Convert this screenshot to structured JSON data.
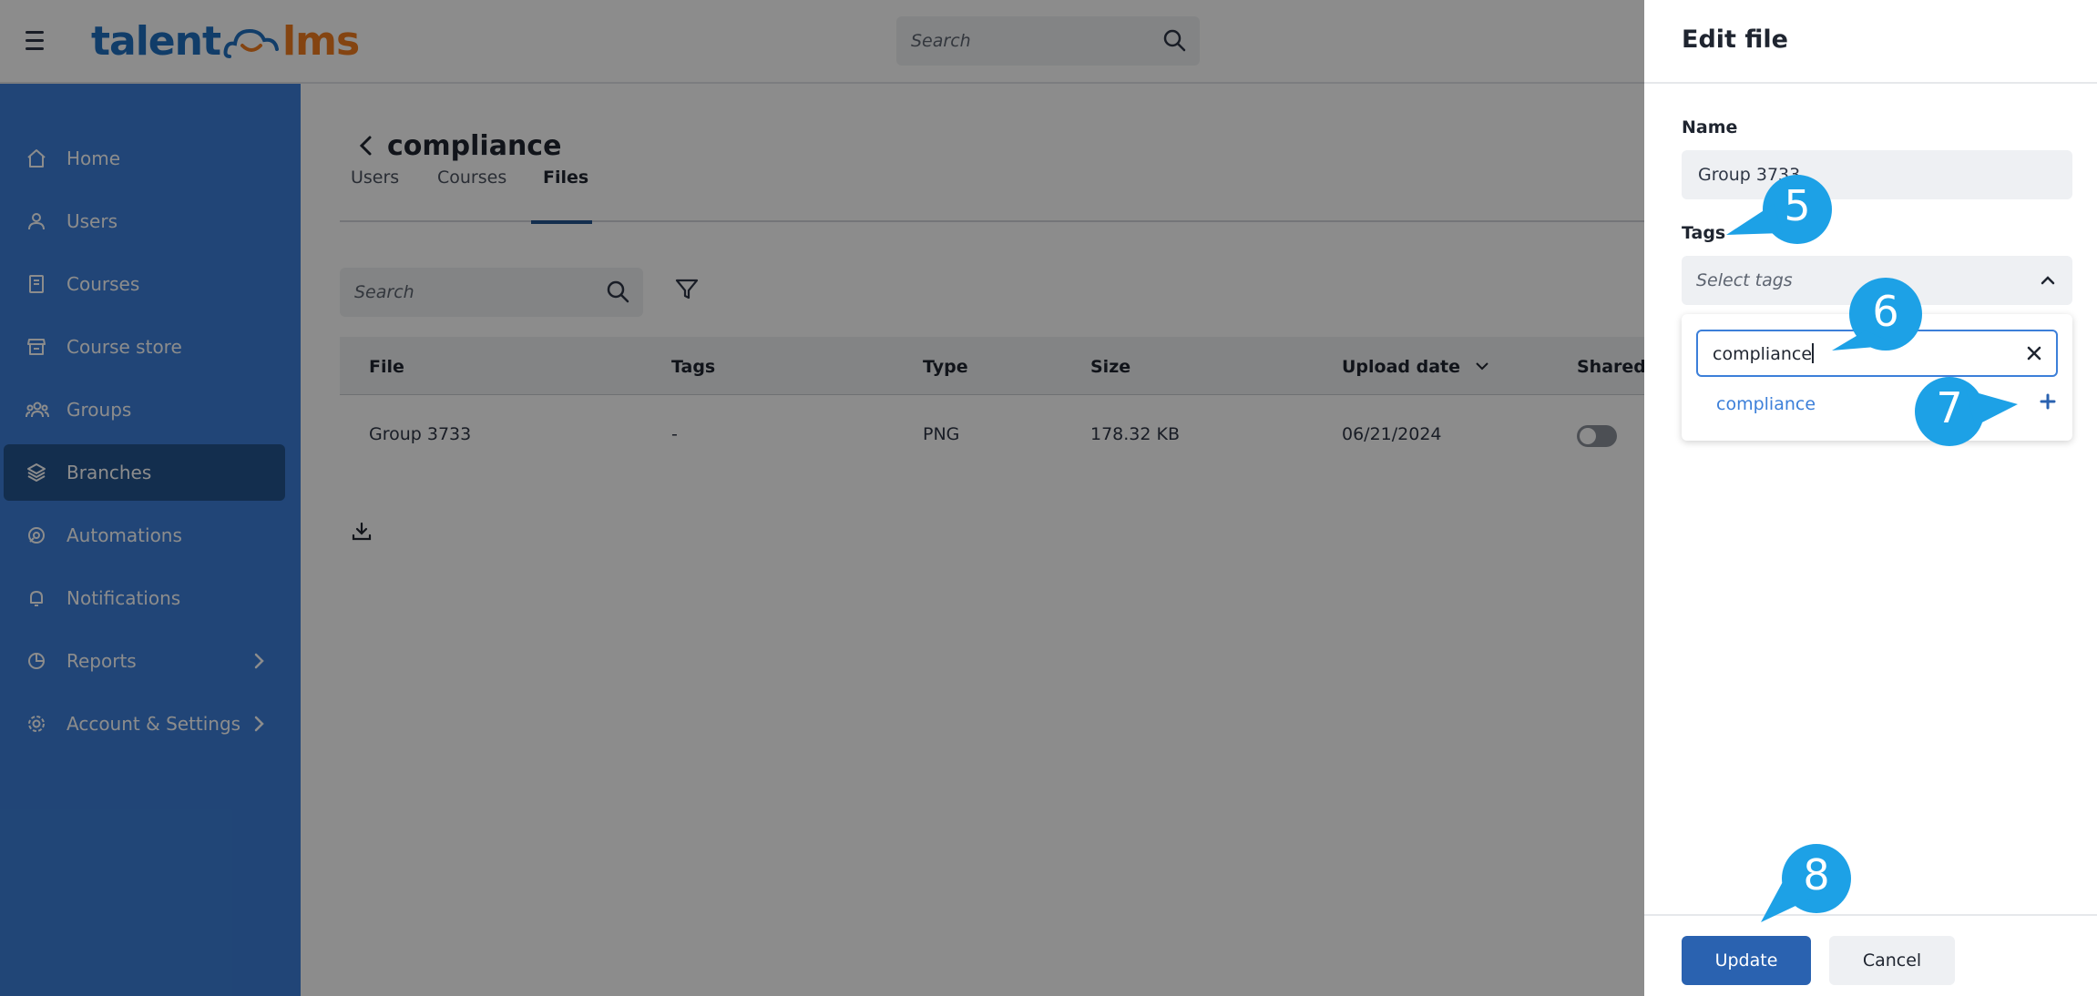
{
  "app": {
    "logo_left": "talent",
    "logo_right": "lms",
    "search_placeholder": "Search"
  },
  "sidebar": {
    "items": [
      {
        "label": "Home",
        "icon": "home-icon"
      },
      {
        "label": "Users",
        "icon": "user-icon"
      },
      {
        "label": "Courses",
        "icon": "book-icon"
      },
      {
        "label": "Course store",
        "icon": "store-icon"
      },
      {
        "label": "Groups",
        "icon": "groups-icon"
      },
      {
        "label": "Branches",
        "icon": "layers-icon",
        "active": true
      },
      {
        "label": "Automations",
        "icon": "automation-icon"
      },
      {
        "label": "Notifications",
        "icon": "bell-icon"
      },
      {
        "label": "Reports",
        "icon": "pie-chart-icon",
        "has_submenu": true
      },
      {
        "label": "Account & Settings",
        "icon": "gear-icon",
        "has_submenu": true
      }
    ]
  },
  "page": {
    "title": "compliance",
    "tabs": [
      "Users",
      "Courses",
      "Files"
    ],
    "active_tab": "Files",
    "search_placeholder": "Search"
  },
  "table": {
    "columns": [
      "File",
      "Tags",
      "Type",
      "Size",
      "Upload date",
      "Shared"
    ],
    "rows": [
      {
        "file": "Group 3733",
        "tags": "-",
        "type": "PNG",
        "size": "178.32 KB",
        "upload_date": "06/21/2024",
        "shared": false
      }
    ]
  },
  "drawer": {
    "title": "Edit file",
    "name_label": "Name",
    "name_value": "Group 3733",
    "tags_label": "Tags",
    "tags_placeholder": "Select tags",
    "tag_search_value": "compliance",
    "tag_option": "compliance",
    "update_label": "Update",
    "cancel_label": "Cancel"
  },
  "callouts": [
    "5",
    "6",
    "7",
    "8"
  ],
  "colors": {
    "sidebar": "#3c7fd9",
    "sidebar_active": "#23548f",
    "primary_button": "#2a62b0",
    "callout": "#1da1e6",
    "logo_blue": "#1f6fc0",
    "logo_orange": "#f07c1f"
  }
}
